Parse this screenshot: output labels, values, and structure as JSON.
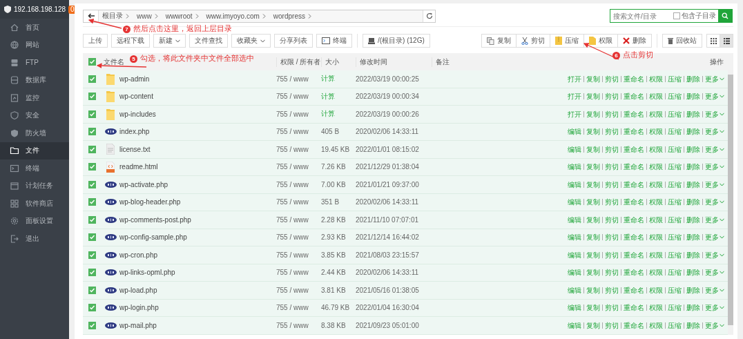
{
  "sidebar": {
    "host": "192.168.198.128",
    "badge": "0",
    "items": [
      {
        "label": "首页",
        "selected": false
      },
      {
        "label": "网站",
        "selected": false
      },
      {
        "label": "FTP",
        "selected": false
      },
      {
        "label": "数据库",
        "selected": false
      },
      {
        "label": "监控",
        "selected": false
      },
      {
        "label": "安全",
        "selected": false
      },
      {
        "label": "防火墙",
        "selected": false
      },
      {
        "label": "文件",
        "selected": true
      },
      {
        "label": "终端",
        "selected": false
      },
      {
        "label": "计划任务",
        "selected": false
      },
      {
        "label": "软件商店",
        "selected": false
      },
      {
        "label": "面板设置",
        "selected": false
      },
      {
        "label": "退出",
        "selected": false
      }
    ]
  },
  "breadcrumb": [
    "根目录",
    "www",
    "wwwroot",
    "www.imyoyo.com",
    "wordpress"
  ],
  "search": {
    "placeholder": "搜索文件/目录",
    "include_subdirs": {
      "label": "包含子目录",
      "checked": false
    }
  },
  "toolbar_left": [
    {
      "label": "上传",
      "dropdown": false
    },
    {
      "label": "远程下载",
      "dropdown": false
    },
    {
      "label": "新建",
      "dropdown": true
    },
    {
      "label": "文件查找",
      "dropdown": false
    },
    {
      "label": "收藏夹",
      "dropdown": true
    },
    {
      "label": "分享列表",
      "dropdown": false
    },
    {
      "label": "终端",
      "dropdown": false
    },
    {
      "label": "/(根目录) (12G)",
      "dropdown": false
    }
  ],
  "toolbar_right": [
    "复制",
    "剪切",
    "压缩",
    "权限",
    "删除"
  ],
  "recycle_bin": "回收站",
  "views": [
    {
      "selected": false
    },
    {
      "selected": true
    }
  ],
  "table": {
    "all_selected": true,
    "columns": [
      "文件名",
      "权限 / 所有者",
      "大小",
      "修改时间",
      "备注",
      "操作"
    ],
    "rows": [
      {
        "kind": "folder",
        "name": "wp-admin",
        "perm": "755 / www",
        "size": "计算",
        "date": "2022/03/19 00:00:25",
        "selected": true,
        "actions": [
          "打开",
          "复制",
          "剪切",
          "重命名",
          "权限",
          "压缩",
          "删除",
          "更多"
        ]
      },
      {
        "kind": "folder",
        "name": "wp-content",
        "perm": "755 / www",
        "size": "计算",
        "date": "2022/03/19 00:00:34",
        "selected": true,
        "actions": [
          "打开",
          "复制",
          "剪切",
          "重命名",
          "权限",
          "压缩",
          "删除",
          "更多"
        ]
      },
      {
        "kind": "folder",
        "name": "wp-includes",
        "perm": "755 / www",
        "size": "计算",
        "date": "2022/03/19 00:00:26",
        "selected": true,
        "actions": [
          "打开",
          "复制",
          "剪切",
          "重命名",
          "权限",
          "压缩",
          "删除",
          "更多"
        ]
      },
      {
        "kind": "php",
        "name": "index.php",
        "perm": "755 / www",
        "size": "405 B",
        "date": "2020/02/06 14:33:11",
        "selected": true,
        "actions": [
          "编辑",
          "复制",
          "剪切",
          "重命名",
          "权限",
          "压缩",
          "删除",
          "更多"
        ]
      },
      {
        "kind": "text",
        "name": "license.txt",
        "perm": "755 / www",
        "size": "19.45 KB",
        "date": "2022/01/01 08:15:02",
        "selected": true,
        "actions": [
          "编辑",
          "复制",
          "剪切",
          "重命名",
          "权限",
          "压缩",
          "删除",
          "更多"
        ]
      },
      {
        "kind": "html",
        "name": "readme.html",
        "perm": "755 / www",
        "size": "7.26 KB",
        "date": "2021/12/29 01:38:04",
        "selected": true,
        "actions": [
          "编辑",
          "复制",
          "剪切",
          "重命名",
          "权限",
          "压缩",
          "删除",
          "更多"
        ]
      },
      {
        "kind": "php",
        "name": "wp-activate.php",
        "perm": "755 / www",
        "size": "7.00 KB",
        "date": "2021/01/21 09:37:00",
        "selected": true,
        "actions": [
          "编辑",
          "复制",
          "剪切",
          "重命名",
          "权限",
          "压缩",
          "删除",
          "更多"
        ]
      },
      {
        "kind": "php",
        "name": "wp-blog-header.php",
        "perm": "755 / www",
        "size": "351 B",
        "date": "2020/02/06 14:33:11",
        "selected": true,
        "actions": [
          "编辑",
          "复制",
          "剪切",
          "重命名",
          "权限",
          "压缩",
          "删除",
          "更多"
        ]
      },
      {
        "kind": "php",
        "name": "wp-comments-post.php",
        "perm": "755 / www",
        "size": "2.28 KB",
        "date": "2021/11/10 07:07:01",
        "selected": true,
        "actions": [
          "编辑",
          "复制",
          "剪切",
          "重命名",
          "权限",
          "压缩",
          "删除",
          "更多"
        ]
      },
      {
        "kind": "php",
        "name": "wp-config-sample.php",
        "perm": "755 / www",
        "size": "2.93 KB",
        "date": "2021/12/14 16:44:02",
        "selected": true,
        "actions": [
          "编辑",
          "复制",
          "剪切",
          "重命名",
          "权限",
          "压缩",
          "删除",
          "更多"
        ]
      },
      {
        "kind": "php",
        "name": "wp-cron.php",
        "perm": "755 / www",
        "size": "3.85 KB",
        "date": "2021/08/03 23:15:57",
        "selected": true,
        "actions": [
          "编辑",
          "复制",
          "剪切",
          "重命名",
          "权限",
          "压缩",
          "删除",
          "更多"
        ]
      },
      {
        "kind": "php",
        "name": "wp-links-opml.php",
        "perm": "755 / www",
        "size": "2.44 KB",
        "date": "2020/02/06 14:33:11",
        "selected": true,
        "actions": [
          "编辑",
          "复制",
          "剪切",
          "重命名",
          "权限",
          "压缩",
          "删除",
          "更多"
        ]
      },
      {
        "kind": "php",
        "name": "wp-load.php",
        "perm": "755 / www",
        "size": "3.81 KB",
        "date": "2021/05/16 01:38:05",
        "selected": true,
        "actions": [
          "编辑",
          "复制",
          "剪切",
          "重命名",
          "权限",
          "压缩",
          "删除",
          "更多"
        ]
      },
      {
        "kind": "php",
        "name": "wp-login.php",
        "perm": "755 / www",
        "size": "46.79 KB",
        "date": "2022/01/04 16:30:04",
        "selected": true,
        "actions": [
          "编辑",
          "复制",
          "剪切",
          "重命名",
          "权限",
          "压缩",
          "删除",
          "更多"
        ]
      },
      {
        "kind": "php",
        "name": "wp-mail.php",
        "perm": "755 / www",
        "size": "8.38 KB",
        "date": "2021/09/23 05:01:00",
        "selected": true,
        "actions": [
          "编辑",
          "复制",
          "剪切",
          "重命名",
          "权限",
          "压缩",
          "删除",
          "更多"
        ]
      }
    ]
  },
  "annotations": [
    {
      "number": "7",
      "text": "然后点击这里，返回上层目录"
    },
    {
      "number": "5",
      "text": "勾选，将此文件夹中文件全部选中"
    },
    {
      "number": "6",
      "text": "点击剪切"
    }
  ]
}
